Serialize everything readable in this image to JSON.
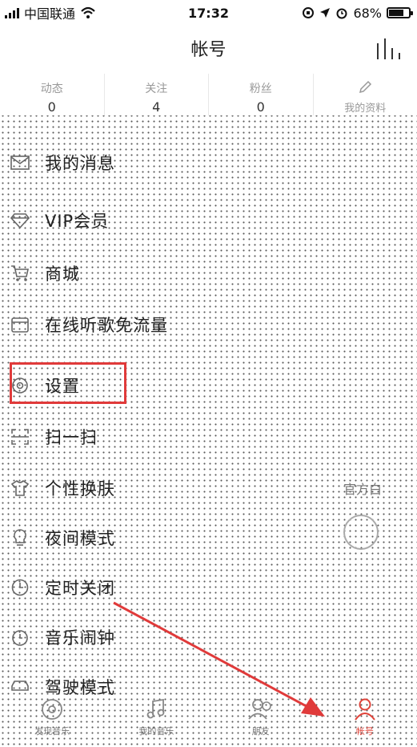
{
  "status_bar": {
    "carrier": "中国联通",
    "time": "17:32",
    "battery": "68%",
    "battery_level": 0.68
  },
  "header": {
    "title": "帐号"
  },
  "stats": [
    {
      "label": "动态",
      "count": "0"
    },
    {
      "label": "关注",
      "count": "4"
    },
    {
      "label": "粉丝",
      "count": "0"
    },
    {
      "label": "我的资料",
      "count": ""
    }
  ],
  "menu": {
    "items": [
      {
        "label": "我的消息",
        "icon": "mail-icon",
        "right": ""
      },
      {
        "label": "VIP会员",
        "icon": "diamond-icon",
        "right": ""
      },
      {
        "label": "商城",
        "icon": "cart-icon",
        "right": ""
      },
      {
        "label": "在线听歌免流量",
        "icon": "card-icon",
        "right": ""
      },
      {
        "label": "设置",
        "icon": "gear-icon",
        "right": ""
      },
      {
        "label": "扫一扫",
        "icon": "scan-icon",
        "right": ""
      },
      {
        "label": "个性换肤",
        "icon": "shirt-icon",
        "right": "官方白"
      },
      {
        "label": "夜间模式",
        "icon": "bulb-icon",
        "right": ""
      },
      {
        "label": "定时关闭",
        "icon": "clock-icon",
        "right": ""
      },
      {
        "label": "音乐闹钟",
        "icon": "alarm-icon",
        "right": ""
      },
      {
        "label": "驾驶模式",
        "icon": "car-icon",
        "right": ""
      }
    ]
  },
  "tabs": [
    {
      "label": "发现音乐",
      "icon": "disc-icon"
    },
    {
      "label": "我的音乐",
      "icon": "music-note-icon"
    },
    {
      "label": "朋友",
      "icon": "friends-icon"
    },
    {
      "label": "帐号",
      "icon": "person-icon"
    }
  ],
  "colors": {
    "accent": "#e0443a",
    "highlight_box": "#e03a3a"
  }
}
